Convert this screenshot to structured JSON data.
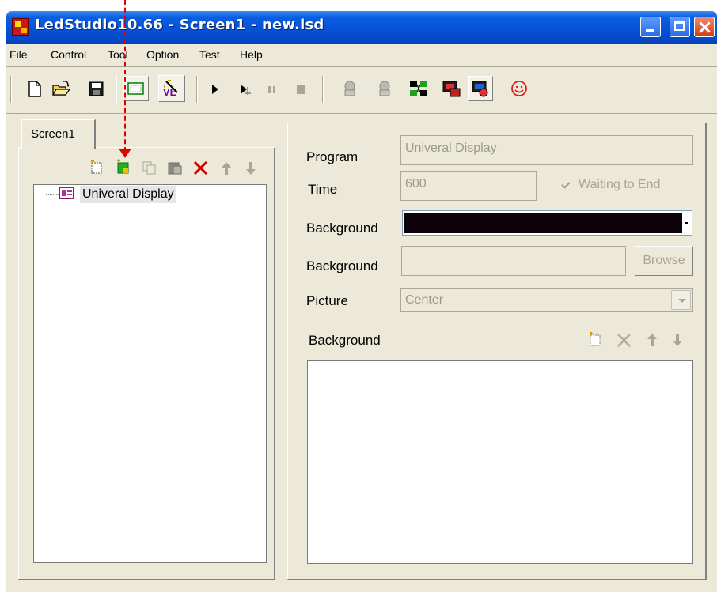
{
  "window": {
    "title": "LedStudio10.66 - Screen1 - new.lsd"
  },
  "menu": {
    "items": [
      "File",
      "Control",
      "Tool",
      "Option",
      "Test",
      "Help"
    ]
  },
  "toolbar": {
    "icons": [
      "new-file-icon",
      "open-folder-icon",
      "save-icon",
      "screen-icon",
      "edit-icon",
      "play-icon",
      "step-play-icon",
      "pause-icon",
      "stop-icon",
      "connect-icon",
      "disconnect-icon",
      "network-icon",
      "send-icon",
      "receive-icon",
      "smiley-icon"
    ]
  },
  "left_panel": {
    "tab_label": "Screen1",
    "tree": {
      "items": [
        {
          "label": "Univeral Display"
        }
      ]
    }
  },
  "right_panel": {
    "program": {
      "label": "Program",
      "value": "Univeral Display"
    },
    "time": {
      "label": "Time",
      "value": "600"
    },
    "waiting": {
      "label": "Waiting to End",
      "checked": true
    },
    "background_color": {
      "label": "Background",
      "color": "#0d0207"
    },
    "background_file": {
      "label": "Background",
      "value": "",
      "browse_label": "Browse"
    },
    "picture": {
      "label": "Picture",
      "value": "Center"
    },
    "background_list": {
      "label": "Background"
    }
  },
  "colors": {
    "titlebar": "#0552d8",
    "window_bg": "#ece9d8",
    "indicator": "#e00000"
  }
}
